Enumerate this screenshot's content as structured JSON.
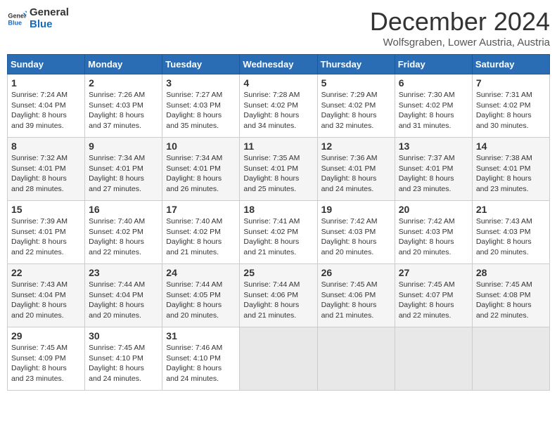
{
  "header": {
    "logo": {
      "general": "General",
      "blue": "Blue"
    },
    "month": "December 2024",
    "location": "Wolfsgraben, Lower Austria, Austria"
  },
  "days_of_week": [
    "Sunday",
    "Monday",
    "Tuesday",
    "Wednesday",
    "Thursday",
    "Friday",
    "Saturday"
  ],
  "weeks": [
    [
      {
        "day": "1",
        "sunrise": "7:24 AM",
        "sunset": "4:04 PM",
        "daylight": "8 hours and 39 minutes."
      },
      {
        "day": "2",
        "sunrise": "7:26 AM",
        "sunset": "4:03 PM",
        "daylight": "8 hours and 37 minutes."
      },
      {
        "day": "3",
        "sunrise": "7:27 AM",
        "sunset": "4:03 PM",
        "daylight": "8 hours and 35 minutes."
      },
      {
        "day": "4",
        "sunrise": "7:28 AM",
        "sunset": "4:02 PM",
        "daylight": "8 hours and 34 minutes."
      },
      {
        "day": "5",
        "sunrise": "7:29 AM",
        "sunset": "4:02 PM",
        "daylight": "8 hours and 32 minutes."
      },
      {
        "day": "6",
        "sunrise": "7:30 AM",
        "sunset": "4:02 PM",
        "daylight": "8 hours and 31 minutes."
      },
      {
        "day": "7",
        "sunrise": "7:31 AM",
        "sunset": "4:02 PM",
        "daylight": "8 hours and 30 minutes."
      }
    ],
    [
      {
        "day": "8",
        "sunrise": "7:32 AM",
        "sunset": "4:01 PM",
        "daylight": "8 hours and 28 minutes."
      },
      {
        "day": "9",
        "sunrise": "7:34 AM",
        "sunset": "4:01 PM",
        "daylight": "8 hours and 27 minutes."
      },
      {
        "day": "10",
        "sunrise": "7:34 AM",
        "sunset": "4:01 PM",
        "daylight": "8 hours and 26 minutes."
      },
      {
        "day": "11",
        "sunrise": "7:35 AM",
        "sunset": "4:01 PM",
        "daylight": "8 hours and 25 minutes."
      },
      {
        "day": "12",
        "sunrise": "7:36 AM",
        "sunset": "4:01 PM",
        "daylight": "8 hours and 24 minutes."
      },
      {
        "day": "13",
        "sunrise": "7:37 AM",
        "sunset": "4:01 PM",
        "daylight": "8 hours and 23 minutes."
      },
      {
        "day": "14",
        "sunrise": "7:38 AM",
        "sunset": "4:01 PM",
        "daylight": "8 hours and 23 minutes."
      }
    ],
    [
      {
        "day": "15",
        "sunrise": "7:39 AM",
        "sunset": "4:01 PM",
        "daylight": "8 hours and 22 minutes."
      },
      {
        "day": "16",
        "sunrise": "7:40 AM",
        "sunset": "4:02 PM",
        "daylight": "8 hours and 22 minutes."
      },
      {
        "day": "17",
        "sunrise": "7:40 AM",
        "sunset": "4:02 PM",
        "daylight": "8 hours and 21 minutes."
      },
      {
        "day": "18",
        "sunrise": "7:41 AM",
        "sunset": "4:02 PM",
        "daylight": "8 hours and 21 minutes."
      },
      {
        "day": "19",
        "sunrise": "7:42 AM",
        "sunset": "4:03 PM",
        "daylight": "8 hours and 20 minutes."
      },
      {
        "day": "20",
        "sunrise": "7:42 AM",
        "sunset": "4:03 PM",
        "daylight": "8 hours and 20 minutes."
      },
      {
        "day": "21",
        "sunrise": "7:43 AM",
        "sunset": "4:03 PM",
        "daylight": "8 hours and 20 minutes."
      }
    ],
    [
      {
        "day": "22",
        "sunrise": "7:43 AM",
        "sunset": "4:04 PM",
        "daylight": "8 hours and 20 minutes."
      },
      {
        "day": "23",
        "sunrise": "7:44 AM",
        "sunset": "4:04 PM",
        "daylight": "8 hours and 20 minutes."
      },
      {
        "day": "24",
        "sunrise": "7:44 AM",
        "sunset": "4:05 PM",
        "daylight": "8 hours and 20 minutes."
      },
      {
        "day": "25",
        "sunrise": "7:44 AM",
        "sunset": "4:06 PM",
        "daylight": "8 hours and 21 minutes."
      },
      {
        "day": "26",
        "sunrise": "7:45 AM",
        "sunset": "4:06 PM",
        "daylight": "8 hours and 21 minutes."
      },
      {
        "day": "27",
        "sunrise": "7:45 AM",
        "sunset": "4:07 PM",
        "daylight": "8 hours and 22 minutes."
      },
      {
        "day": "28",
        "sunrise": "7:45 AM",
        "sunset": "4:08 PM",
        "daylight": "8 hours and 22 minutes."
      }
    ],
    [
      {
        "day": "29",
        "sunrise": "7:45 AM",
        "sunset": "4:09 PM",
        "daylight": "8 hours and 23 minutes."
      },
      {
        "day": "30",
        "sunrise": "7:45 AM",
        "sunset": "4:10 PM",
        "daylight": "8 hours and 24 minutes."
      },
      {
        "day": "31",
        "sunrise": "7:46 AM",
        "sunset": "4:10 PM",
        "daylight": "8 hours and 24 minutes."
      },
      null,
      null,
      null,
      null
    ]
  ],
  "labels": {
    "sunrise": "Sunrise:",
    "sunset": "Sunset:",
    "daylight": "Daylight:"
  }
}
